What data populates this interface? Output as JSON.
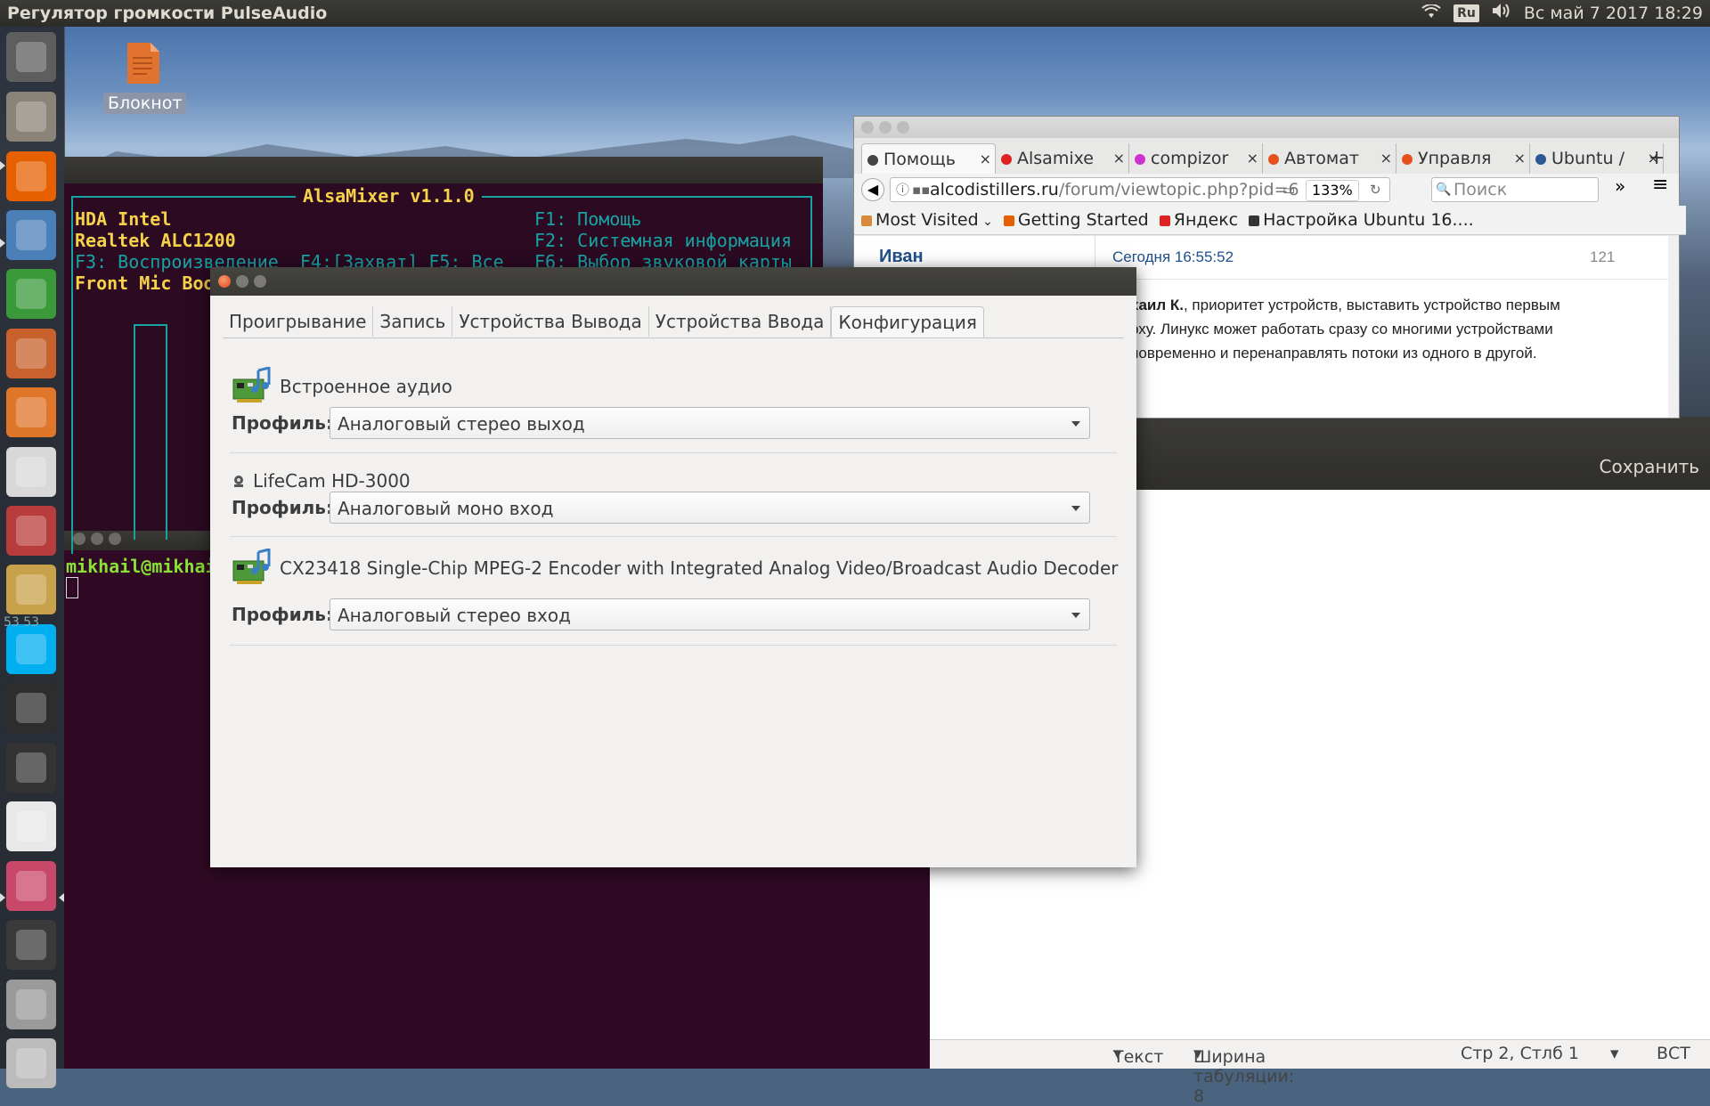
{
  "top_panel": {
    "title": "Регулятор громкости PulseAudio",
    "keyboard_layout": "Ru",
    "clock": "Вс май  7 2017 18:29"
  },
  "launcher": {
    "items": [
      {
        "name": "dash-icon",
        "color": "#5e5e5e"
      },
      {
        "name": "files-icon",
        "color": "#8a8378"
      },
      {
        "name": "firefox-icon",
        "color": "#e66000"
      },
      {
        "name": "image-viewer-icon",
        "color": "#4a7fb8"
      },
      {
        "name": "spreadsheet-icon",
        "color": "#3a9a3a"
      },
      {
        "name": "presentation-icon",
        "color": "#c9612c"
      },
      {
        "name": "software-center-icon",
        "color": "#e0762a"
      },
      {
        "name": "amazon-icon",
        "color": "#d8d8d8"
      },
      {
        "name": "system-settings-icon",
        "color": "#b73c3c"
      },
      {
        "name": "archive-manager-icon",
        "color": "#c8a24a"
      },
      {
        "name": "skype-icon",
        "color": "#00aff0"
      },
      {
        "name": "terminal-icon",
        "color": "#2d2d2d"
      },
      {
        "name": "video-editor-icon",
        "color": "#333333"
      },
      {
        "name": "text-editor-icon",
        "color": "#e8e8e8"
      },
      {
        "name": "volume-control-icon",
        "color": "#c8486a"
      },
      {
        "name": "save-icon",
        "color": "#3a3a3a"
      },
      {
        "name": "disk-icon",
        "color": "#9a9a9a"
      },
      {
        "name": "trash-icon",
        "color": "#bbbbbb"
      }
    ],
    "badge": "53 53"
  },
  "desktop": {
    "notepad_label": "Блокнот"
  },
  "alsamixer": {
    "title": "AlsaMixer v1.1.0",
    "card": "HDA Intel",
    "chip": "Realtek ALC1200",
    "views": "F3: Воспроизведение  F4:[Захват] F5: Все",
    "help": "F1: Помощь",
    "sysinfo": "F2: Системная информация",
    "select_card": "F6: Выбор звуковой карты",
    "control": "Front Mic Boo"
  },
  "terminal": {
    "prompt": "mikhail@mikhai"
  },
  "firefox": {
    "tabs": [
      {
        "label": "Помощь",
        "close": "×"
      },
      {
        "label": "Alsamixe",
        "close": "×"
      },
      {
        "label": "compizor",
        "close": "×"
      },
      {
        "label": "Автомат",
        "close": "×"
      },
      {
        "label": "Управля",
        "close": "×"
      },
      {
        "label": "Ubuntu /",
        "close": "×"
      }
    ],
    "new_tab": "+",
    "url_domain": "alcodistillers.ru",
    "url_path": "/forum/viewtopic.php?pid=6",
    "zoom": "133%",
    "search_placeholder": "Поиск",
    "bookmarks": [
      "Most Visited",
      "Getting Started",
      "Яндекс",
      "Настройка Ubuntu 16...."
    ],
    "post": {
      "author": "Иван",
      "time": "Сегодня 16:55:52",
      "number": "121",
      "lines": [
        {
          "bold": "хаил К.",
          "text": ", приоритет устройств, выставить устройство первым"
        },
        {
          "bold": "",
          "text": "рху. Линукс может работать сразу со многими устройствами"
        },
        {
          "bold": "",
          "text": "новременно и перенаправлять потоки из одного в другой."
        }
      ]
    }
  },
  "gedit": {
    "save_label": "Сохранить",
    "status": {
      "syntax": "Текст",
      "tab_width": "Ширина табуляции: 8",
      "position": "Стр 2, Стлб 1",
      "mode": "ВСТ"
    }
  },
  "pavucontrol": {
    "tabs": [
      "Проигрывание",
      "Запись",
      "Устройства Вывода",
      "Устройства Ввода",
      "Конфигурация"
    ],
    "active_tab": "Конфигурация",
    "profile_label": "Профиль:",
    "cards": [
      {
        "name": "Встроенное аудио",
        "profile": "Аналоговый стерео выход"
      },
      {
        "name": "LifeCam HD-3000",
        "profile": "Аналоговый моно вход"
      },
      {
        "name": "CX23418 Single-Chip MPEG-2 Encoder with Integrated Analog Video/Broadcast Audio Decoder",
        "profile": "Аналоговый стерео вход"
      }
    ]
  }
}
